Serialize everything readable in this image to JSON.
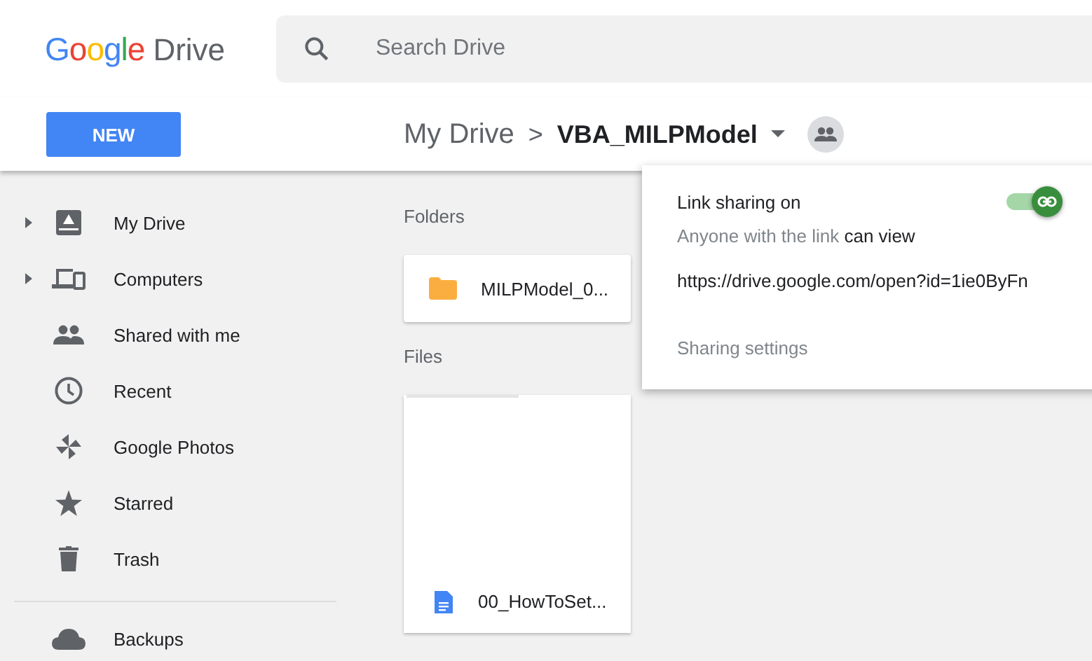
{
  "logo": {
    "brand": "Google",
    "product": "Drive"
  },
  "search": {
    "placeholder": "Search Drive"
  },
  "new_button": "NEW",
  "breadcrumb": {
    "parent": "My Drive",
    "separator": ">",
    "current": "VBA_MILPModel"
  },
  "sidebar": {
    "items": [
      {
        "label": "My Drive",
        "expandable": true
      },
      {
        "label": "Computers",
        "expandable": true
      },
      {
        "label": "Shared with me",
        "expandable": false
      },
      {
        "label": "Recent",
        "expandable": false
      },
      {
        "label": "Google Photos",
        "expandable": false
      },
      {
        "label": "Starred",
        "expandable": false
      },
      {
        "label": "Trash",
        "expandable": false
      }
    ],
    "footer_items": [
      {
        "label": "Backups"
      }
    ]
  },
  "folders": {
    "heading": "Folders",
    "items": [
      {
        "name": "MILPModel_0..."
      }
    ]
  },
  "files": {
    "heading": "Files",
    "items": [
      {
        "name": "00_HowToSet..."
      }
    ]
  },
  "share_popup": {
    "title": "Link sharing on",
    "on": true,
    "access": "Anyone with the link **can view**",
    "url": "https://drive.google.com/open?id=1ie0ByFn",
    "settings_link": "Sharing settings"
  }
}
